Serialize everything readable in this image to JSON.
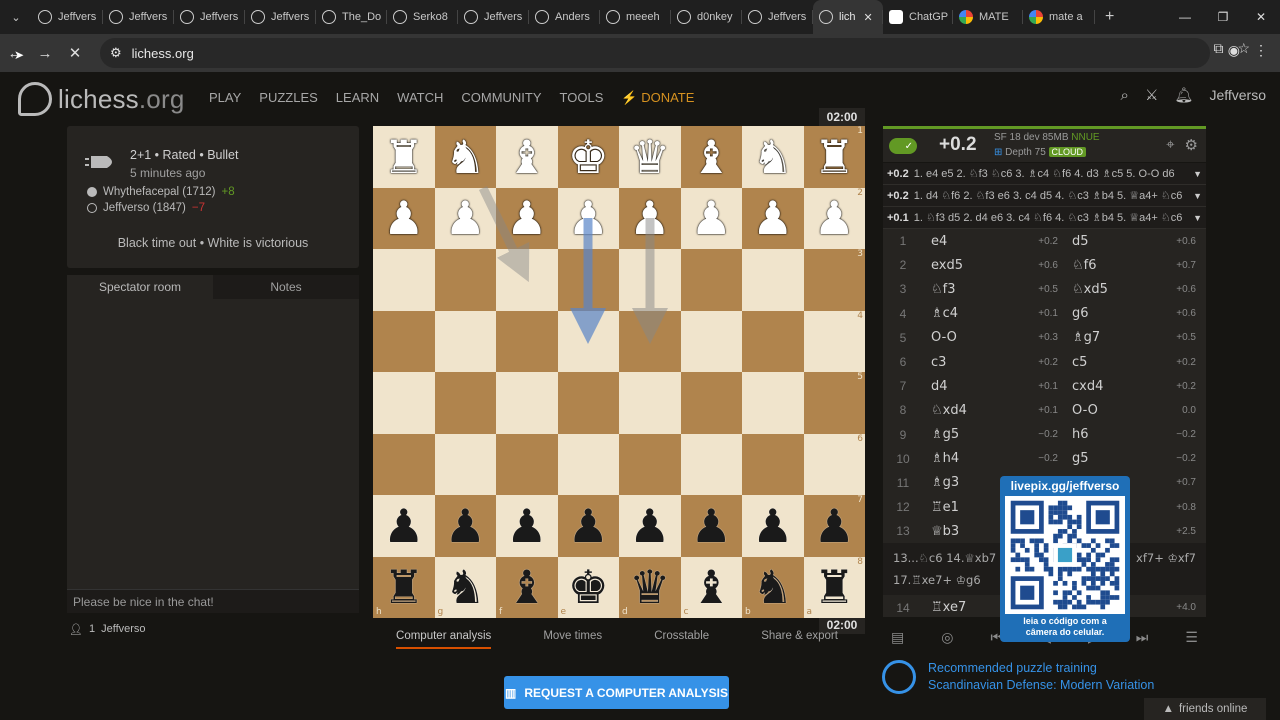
{
  "browser": {
    "tabs": [
      {
        "label": "Jeffvers",
        "icon": "lichess",
        "active": false
      },
      {
        "label": "Jeffvers",
        "icon": "lichess",
        "active": false
      },
      {
        "label": "Jeffvers",
        "icon": "lichess",
        "active": false
      },
      {
        "label": "Jeffvers",
        "icon": "lichess",
        "active": false
      },
      {
        "label": "The_Do",
        "icon": "lichess",
        "active": false
      },
      {
        "label": "Serko8",
        "icon": "lichess",
        "active": false
      },
      {
        "label": "Jeffvers",
        "icon": "lichess",
        "active": false
      },
      {
        "label": "Anders",
        "icon": "lichess",
        "active": false
      },
      {
        "label": "meeeh",
        "icon": "lichess",
        "active": false
      },
      {
        "label": "d0nkey",
        "icon": "lichess",
        "active": false
      },
      {
        "label": "Jeffvers",
        "icon": "lichess",
        "active": false
      },
      {
        "label": "lich",
        "icon": "lichess",
        "active": true
      },
      {
        "label": "ChatGP",
        "icon": "chatgpt",
        "active": false
      },
      {
        "label": "MATE",
        "icon": "google",
        "active": false
      },
      {
        "label": "mate a",
        "icon": "google",
        "active": false
      }
    ],
    "new_tab": "+",
    "url": "lichess.org"
  },
  "site": {
    "logo_main": "lichess",
    "logo_org": ".org",
    "menu": [
      "PLAY",
      "PUZZLES",
      "LEARN",
      "WATCH",
      "COMMUNITY",
      "TOOLS"
    ],
    "donate": "DONATE",
    "username": "Jeffverso"
  },
  "game": {
    "type": "2+1 • Rated • Bullet",
    "ago": "5 minutes ago",
    "white_player": "Whythefacepal (1712)",
    "white_diff": "+8",
    "black_player": "Jeffverso (1847)",
    "black_diff": "−7",
    "result": "Black time out • White is victorious"
  },
  "chat": {
    "tab_spectator": "Spectator room",
    "tab_notes": "Notes",
    "placeholder": "Please be nice in the chat!",
    "watchers_count": "1",
    "watcher": "Jeffverso"
  },
  "board": {
    "clock_top": "02:00",
    "clock_bottom": "02:00",
    "ranks": [
      "1",
      "2",
      "3",
      "4",
      "5",
      "6",
      "7",
      "8"
    ],
    "files": [
      "h",
      "g",
      "f",
      "e",
      "d",
      "c",
      "b",
      "a"
    ],
    "rows": [
      [
        "♜",
        "♞",
        "♝",
        "♚",
        "♛",
        "♝",
        "♞",
        "♜"
      ],
      [
        "♟",
        "♟",
        "♟",
        "♟",
        "♟",
        "♟",
        "♟",
        "♟"
      ],
      [
        "",
        "",
        "",
        "",
        "",
        "",
        "",
        ""
      ],
      [
        "",
        "",
        "",
        "",
        "",
        "",
        "",
        ""
      ],
      [
        "",
        "",
        "",
        "",
        "",
        "",
        "",
        ""
      ],
      [
        "",
        "",
        "",
        "",
        "",
        "",
        "",
        ""
      ],
      [
        "♟",
        "♟",
        "♟",
        "♟",
        "♟",
        "♟",
        "♟",
        "♟"
      ],
      [
        "♜",
        "♞",
        "♝",
        "♚",
        "♛",
        "♝",
        "♞",
        "♜"
      ]
    ],
    "white_rows": [
      0,
      1
    ]
  },
  "analysis_tabs": [
    "Computer analysis",
    "Move times",
    "Crosstable",
    "Share & export"
  ],
  "request_button": "REQUEST A COMPUTER ANALYSIS",
  "ceval": {
    "score": "+0.2",
    "engine": "SF 18 dev 85MB",
    "nnue": "NNUE",
    "depth": "Depth 75",
    "cloud": "CLOUD",
    "pvs": [
      {
        "score": "+0.2",
        "line": "1. e4 e5 2. ♘f3 ♘c6 3. ♗c4 ♘f6 4. d3 ♗c5 5. O-O d6"
      },
      {
        "score": "+0.2",
        "line": "1. d4 ♘f6 2. ♘f3 e6 3. c4 d5 4. ♘c3 ♗b4 5. ♕a4+ ♘c6"
      },
      {
        "score": "+0.1",
        "line": "1. ♘f3 d5 2. d4 e6 3. c4 ♘f6 4. ♘c3 ♗b4 5. ♕a4+ ♘c6"
      }
    ]
  },
  "moves": [
    {
      "n": "1",
      "w": "e4",
      "we": "+0.2",
      "b": "d5",
      "be": "+0.6"
    },
    {
      "n": "2",
      "w": "exd5",
      "we": "+0.6",
      "b": "♘f6",
      "be": "+0.7"
    },
    {
      "n": "3",
      "w": "♘f3",
      "we": "+0.5",
      "b": "♘xd5",
      "be": "+0.6"
    },
    {
      "n": "4",
      "w": "♗c4",
      "we": "+0.1",
      "b": "g6",
      "be": "+0.6"
    },
    {
      "n": "5",
      "w": "O-O",
      "we": "+0.3",
      "b": "♗g7",
      "be": "+0.5"
    },
    {
      "n": "6",
      "w": "c3",
      "we": "+0.2",
      "b": "c5",
      "be": "+0.2"
    },
    {
      "n": "7",
      "w": "d4",
      "we": "+0.1",
      "b": "cxd4",
      "be": "+0.2"
    },
    {
      "n": "8",
      "w": "♘xd4",
      "we": "+0.1",
      "b": "O-O",
      "be": "0.0"
    },
    {
      "n": "9",
      "w": "♗g5",
      "we": "−0.2",
      "b": "h6",
      "be": "−0.2"
    },
    {
      "n": "10",
      "w": "♗h4",
      "we": "−0.2",
      "b": "g5",
      "be": "−0.2"
    },
    {
      "n": "11",
      "w": "♗g3",
      "we": "",
      "b": "",
      "be": "+0.7"
    },
    {
      "n": "12",
      "w": "♖e1",
      "we": "",
      "b": "",
      "be": "+0.8"
    },
    {
      "n": "13",
      "w": "♕b3",
      "we": "",
      "b": "",
      "be": "+2.5"
    }
  ],
  "variation_line1": "13...♘c6 14.♕xb7",
  "variation_line1_end": "xf7+ ♔xf7",
  "variation_line2": "17.♖xe7+ ♔g6",
  "move14": {
    "n": "14",
    "w": "♖xe7",
    "be": "+4.0"
  },
  "puzzle": {
    "title": "Recommended puzzle training",
    "subtitle": "Scandinavian Defense: Modern Variation"
  },
  "friends": "friends online",
  "qr": {
    "title": "livepix.gg/jeffverso",
    "caption_line1": "leia o código com a",
    "caption_line2": "câmera do celular."
  }
}
